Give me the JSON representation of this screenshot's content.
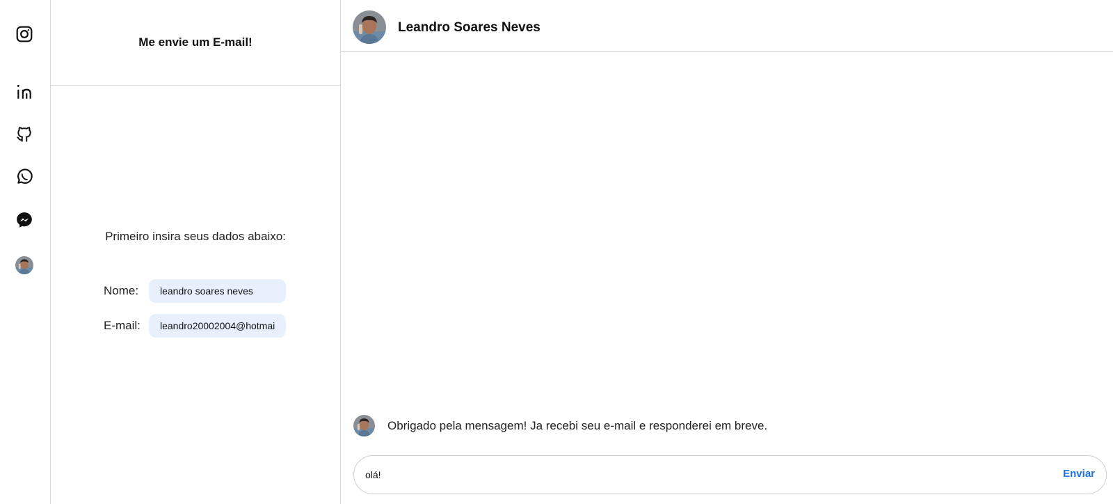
{
  "sidebar": {
    "icons": [
      "instagram-icon",
      "linkedin-icon",
      "github-icon",
      "whatsapp-icon",
      "messenger-icon"
    ]
  },
  "form": {
    "title": "Me envie um E-mail!",
    "instruction": "Primeiro insira seus dados abaixo:",
    "name_label": "Nome:",
    "name_value": "leandro soares neves",
    "email_label": "E-mail:",
    "email_value": "leandro20002004@hotmai"
  },
  "chat": {
    "contact_name": "Leandro Soares Neves",
    "messages": [
      {
        "text": "Obrigado pela mensagem! Ja recebi seu e-mail e responderei em breve."
      }
    ],
    "composer_value": "olá!",
    "send_label": "Enviar"
  },
  "colors": {
    "input_bg": "#e8f0fe",
    "accent": "#1a73e8",
    "border": "#d9d9d9"
  }
}
